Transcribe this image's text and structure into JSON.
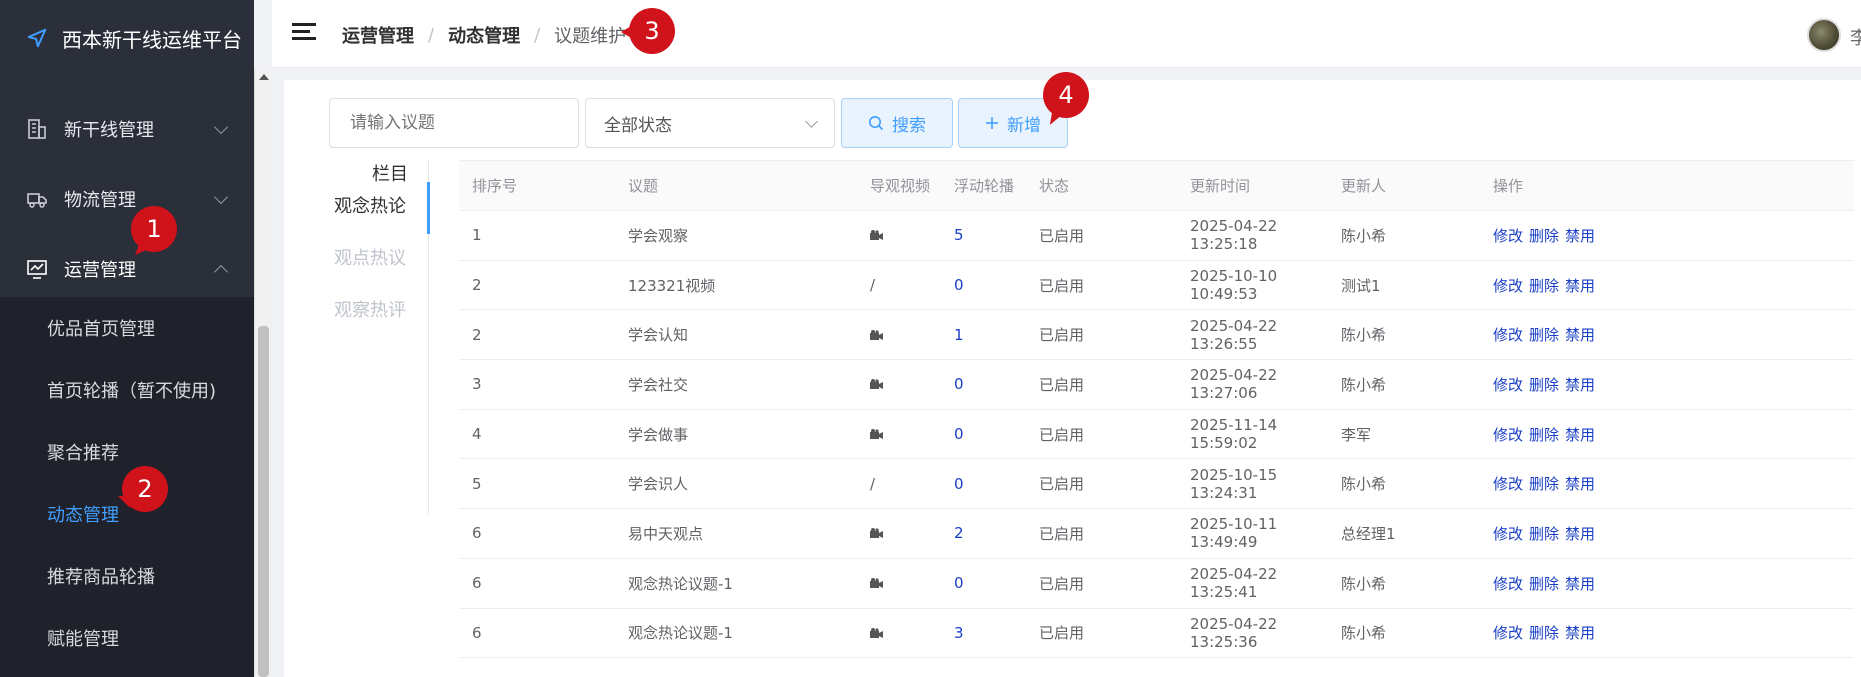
{
  "app": {
    "title": "西本新干线运维平台"
  },
  "sidebar": {
    "menu": [
      {
        "label": "新干线管理",
        "icon": "building-icon"
      },
      {
        "label": "物流管理",
        "icon": "truck-icon"
      },
      {
        "label": "运营管理",
        "icon": "monitor-chart-icon",
        "expanded": true
      }
    ],
    "submenu": [
      {
        "label": "优品首页管理"
      },
      {
        "label": "首页轮播（暂不使用)"
      },
      {
        "label": "聚合推荐"
      },
      {
        "label": "动态管理",
        "active": true
      },
      {
        "label": "推荐商品轮播"
      },
      {
        "label": "赋能管理"
      }
    ]
  },
  "header": {
    "breadcrumb": [
      "运营管理",
      "动态管理",
      "议题维护"
    ],
    "separator": "/",
    "user_initial": "李"
  },
  "toolbar": {
    "search_placeholder": "请输入议题",
    "status_select_value": "全部状态",
    "search_label": "搜索",
    "add_label": "新增"
  },
  "columns_panel": {
    "header": "栏目",
    "tabs": [
      {
        "label": "观念热论",
        "active": true
      },
      {
        "label": "观点热议"
      },
      {
        "label": "观察热评"
      }
    ]
  },
  "table": {
    "headers": [
      "排序号",
      "议题",
      "导观视频",
      "浮动轮播",
      "状态",
      "更新时间",
      "更新人",
      "操作"
    ],
    "actions": [
      "修改",
      "删除",
      "禁用"
    ],
    "rows": [
      {
        "order": "1",
        "topic": "学会观察",
        "video": "camera",
        "carousel": "5",
        "status": "已启用",
        "updated": "2025-04-22 13:25:18",
        "updater": "陈小希"
      },
      {
        "order": "2",
        "topic": "123321视频",
        "video": "/",
        "carousel": "0",
        "status": "已启用",
        "updated": "2025-10-10 10:49:53",
        "updater": "测试1"
      },
      {
        "order": "2",
        "topic": "学会认知",
        "video": "camera",
        "carousel": "1",
        "status": "已启用",
        "updated": "2025-04-22 13:26:55",
        "updater": "陈小希"
      },
      {
        "order": "3",
        "topic": "学会社交",
        "video": "camera",
        "carousel": "0",
        "status": "已启用",
        "updated": "2025-04-22 13:27:06",
        "updater": "陈小希"
      },
      {
        "order": "4",
        "topic": "学会做事",
        "video": "camera",
        "carousel": "0",
        "status": "已启用",
        "updated": "2025-11-14 15:59:02",
        "updater": "李军"
      },
      {
        "order": "5",
        "topic": "学会识人",
        "video": "/",
        "carousel": "0",
        "status": "已启用",
        "updated": "2025-10-15 13:24:31",
        "updater": "陈小希"
      },
      {
        "order": "6",
        "topic": "易中天观点",
        "video": "camera",
        "carousel": "2",
        "status": "已启用",
        "updated": "2025-10-11 13:49:49",
        "updater": "总经理1"
      },
      {
        "order": "6",
        "topic": "观念热论议题-1",
        "video": "camera",
        "carousel": "0",
        "status": "已启用",
        "updated": "2025-04-22 13:25:41",
        "updater": "陈小希"
      },
      {
        "order": "6",
        "topic": "观念热论议题-1",
        "video": "camera",
        "carousel": "3",
        "status": "已启用",
        "updated": "2025-04-22 13:25:36",
        "updater": "陈小希"
      }
    ]
  },
  "annotations": [
    "1",
    "2",
    "3",
    "4"
  ],
  "colors": {
    "sidebar_bg": "#2b2f3a",
    "submenu_bg": "#1f222b",
    "accent": "#409eff",
    "link": "#1a3fc7",
    "badge": "#d0121b"
  }
}
